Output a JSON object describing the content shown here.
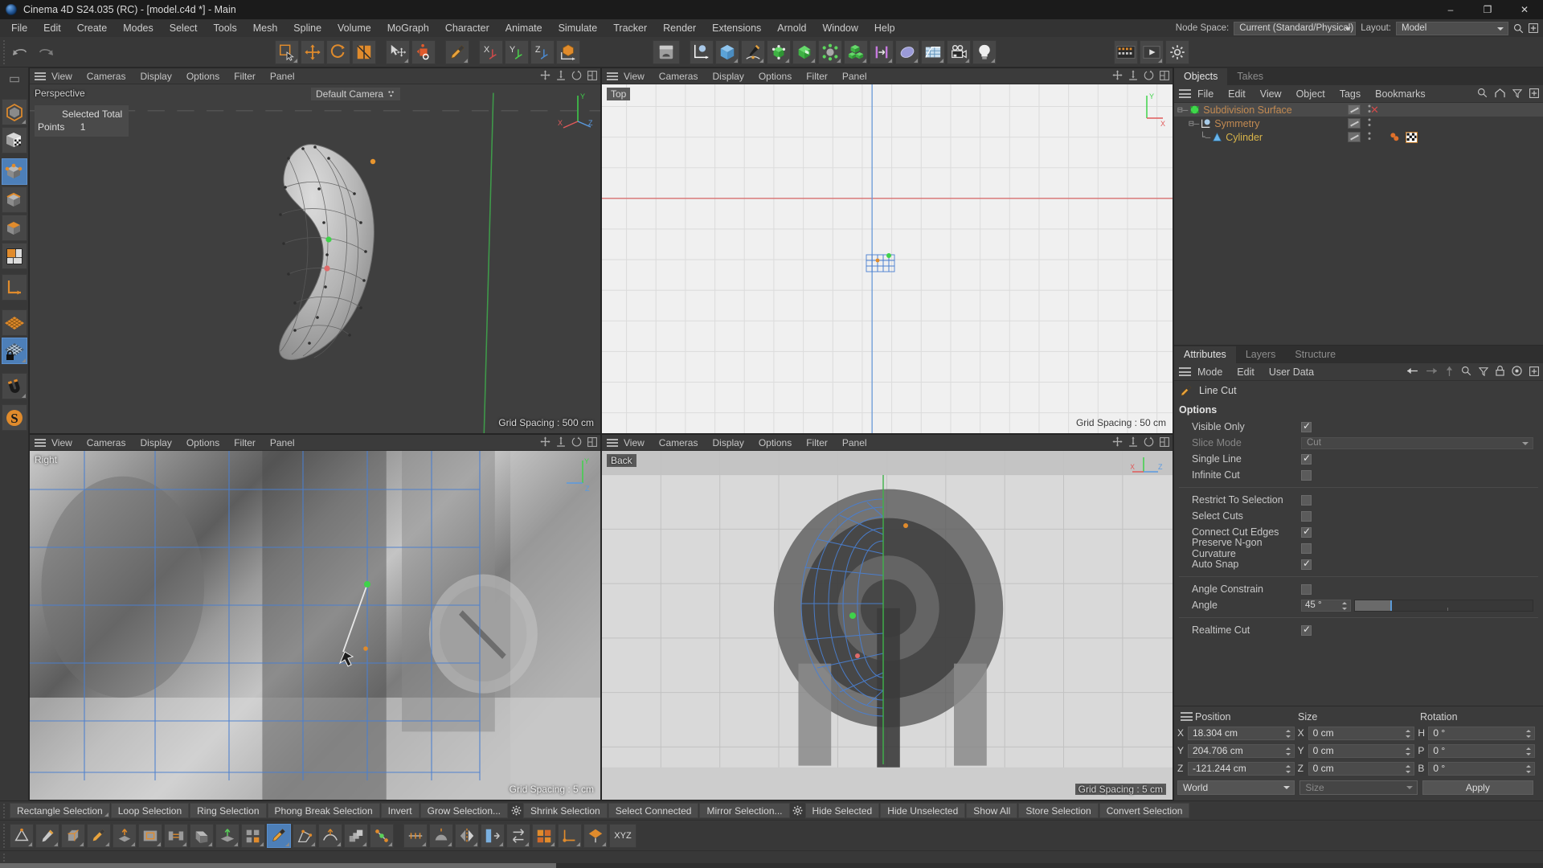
{
  "window": {
    "title": "Cinema 4D S24.035 (RC) - [model.c4d *] - Main",
    "minimize": "–",
    "maximize": "❐",
    "close": "✕"
  },
  "menubar": {
    "items": [
      "File",
      "Edit",
      "Create",
      "Modes",
      "Select",
      "Tools",
      "Mesh",
      "Spline",
      "Volume",
      "MoGraph",
      "Character",
      "Animate",
      "Simulate",
      "Tracker",
      "Render",
      "Extensions",
      "Arnold",
      "Window",
      "Help"
    ],
    "node_space_label": "Node Space:",
    "node_space_value": "Current (Standard/Physical)",
    "layout_label": "Layout:",
    "layout_value": "Model"
  },
  "toolbar": {
    "undo": "undo-icon",
    "redo": "redo-icon",
    "live_selection": "live-selection-icon",
    "move": "move-icon",
    "scale": "scale-icon",
    "rotate": "rotate-icon",
    "move_tool2": "move-axis-icon",
    "rotate_tool2": "rotate-world-icon",
    "knife": "knife-icon",
    "lock_x": "X",
    "lock_y": "Y",
    "lock_z": "Z",
    "world_object": "world-object-icon",
    "content_browser": "content-browser-icon",
    "null_object": "null-object-icon",
    "cube_primitive": "cube-primitive-icon",
    "pen_spline": "pen-spline-icon",
    "array_generator": "array-generator-icon",
    "subdivision_surface": "subdivision-surface-icon",
    "bend_deformer": "bend-deformer-icon",
    "cloner": "cloner-icon",
    "mograph_effector": "mograph-effector-icon",
    "field": "field-icon",
    "scene_nodes": "scene-nodes-icon",
    "camera": "camera-icon",
    "light": "light-icon",
    "render_view": "render-view-icon",
    "render_picture": "render-picture-icon",
    "render_settings": "render-settings-icon"
  },
  "leftbar": {
    "items": [
      {
        "name": "model-mode",
        "active": false
      },
      {
        "name": "texture-mode",
        "active": false
      },
      {
        "name": "points-mode",
        "active": true
      },
      {
        "name": "edges-mode",
        "active": false
      },
      {
        "name": "polygons-mode",
        "active": false
      },
      {
        "name": "uv-mode",
        "active": false
      },
      {
        "name": "axis-mode",
        "active": false
      },
      {
        "name": "workplane-mode",
        "active": false
      },
      {
        "name": "lock-workplane-mode",
        "active": true
      },
      {
        "name": "snap-mode",
        "active": false
      },
      {
        "name": "sculpt-mode",
        "active": false
      }
    ]
  },
  "viewport_menu": [
    "View",
    "Cameras",
    "Display",
    "Options",
    "Filter",
    "Panel"
  ],
  "viewports": [
    {
      "name": "perspective",
      "label": "Perspective",
      "camera": "Default Camera",
      "grid_spacing": "Grid Spacing : 500 cm",
      "grid_boxed": false,
      "selection_info": {
        "header": "Selected Total",
        "row_label": "Points",
        "row_value": "1"
      }
    },
    {
      "name": "top",
      "label": "Top",
      "grid_spacing": "Grid Spacing : 50 cm",
      "grid_boxed": false
    },
    {
      "name": "right",
      "label": "Right",
      "grid_spacing": "Grid Spacing : 5 cm",
      "grid_boxed": false
    },
    {
      "name": "back",
      "label": "Back",
      "grid_spacing": "Grid Spacing : 5 cm",
      "grid_boxed": true
    }
  ],
  "object_manager": {
    "tabs": [
      {
        "label": "Objects",
        "selected": true
      },
      {
        "label": "Takes",
        "selected": false
      }
    ],
    "menu": [
      "File",
      "Edit",
      "View",
      "Object",
      "Tags",
      "Bookmarks"
    ],
    "icons": [
      "search-icon",
      "home-icon",
      "filter-icon",
      "add-icon"
    ],
    "items": [
      {
        "name": "Subdivision Surface",
        "color": "#c28a52",
        "indent": 0,
        "selected": true,
        "icon": "subdivision-surface-icon",
        "has_x": true,
        "tags": []
      },
      {
        "name": "Symmetry",
        "color": "#c28a52",
        "indent": 1,
        "selected": false,
        "icon": "symmetry-icon",
        "has_x": false,
        "tags": []
      },
      {
        "name": "Cylinder",
        "color": "#d8b44a",
        "indent": 2,
        "selected": false,
        "icon": "cylinder-icon",
        "has_x": false,
        "tags": [
          "material-tag",
          "checker-tag"
        ]
      }
    ]
  },
  "attributes": {
    "tabs": [
      {
        "label": "Attributes",
        "selected": true
      },
      {
        "label": "Layers",
        "selected": false
      },
      {
        "label": "Structure",
        "selected": false
      }
    ],
    "menu": [
      "Mode",
      "Edit",
      "User Data"
    ],
    "icons": [
      "back-arrow-icon",
      "forward-arrow-icon",
      "up-arrow-icon",
      "search-icon",
      "filter-icon",
      "lock-icon",
      "target-icon",
      "add-icon"
    ],
    "tool_title": "Line Cut",
    "tool_icon": "knife-icon",
    "section_title": "Options",
    "rows": [
      {
        "label": "Visible Only",
        "type": "checkbox",
        "checked": true,
        "dim": false
      },
      {
        "label": "Slice Mode",
        "type": "dropdown",
        "value": "Cut",
        "dim": true
      },
      {
        "label": "Single Line",
        "type": "checkbox",
        "checked": true,
        "dim": false
      },
      {
        "label": "Infinite Cut",
        "type": "checkbox",
        "checked": false,
        "dim": false
      },
      {
        "label": "__sep__",
        "type": "separator"
      },
      {
        "label": "Restrict To Selection",
        "type": "checkbox",
        "checked": false,
        "dim": false
      },
      {
        "label": "Select Cuts",
        "type": "checkbox",
        "checked": false,
        "dim": false
      },
      {
        "label": "Connect Cut Edges",
        "type": "checkbox",
        "checked": true,
        "dim": false
      },
      {
        "label": "Preserve N-gon Curvature",
        "type": "checkbox",
        "checked": false,
        "dim": false
      },
      {
        "label": "Auto Snap",
        "type": "checkbox",
        "checked": true,
        "dim": false
      },
      {
        "label": "__sep__",
        "type": "separator"
      },
      {
        "label": "Angle Constrain",
        "type": "checkbox",
        "checked": false,
        "dim": false
      },
      {
        "label": "Angle",
        "type": "slider",
        "value": "45 °",
        "fill_percent": 20
      },
      {
        "label": "__sep__",
        "type": "separator"
      },
      {
        "label": "Realtime Cut",
        "type": "checkbox",
        "checked": true,
        "dim": false
      }
    ]
  },
  "coordinates": {
    "headers": [
      "Position",
      "Size",
      "Rotation"
    ],
    "position": [
      {
        "axis": "X",
        "value": "18.304 cm"
      },
      {
        "axis": "Y",
        "value": "204.706 cm"
      },
      {
        "axis": "Z",
        "value": "-121.244 cm"
      }
    ],
    "size": [
      {
        "axis": "X",
        "value": "0 cm"
      },
      {
        "axis": "Y",
        "value": "0 cm"
      },
      {
        "axis": "Z",
        "value": "0 cm"
      }
    ],
    "rotation": [
      {
        "axis": "H",
        "value": "0 °"
      },
      {
        "axis": "P",
        "value": "0 °"
      },
      {
        "axis": "B",
        "value": "0 °"
      }
    ],
    "coord_system": "World",
    "size_mode": "Size",
    "apply": "Apply"
  },
  "selection_toolbar": {
    "buttons": [
      {
        "label": "Rectangle Selection",
        "corner": true,
        "gear": false
      },
      {
        "label": "Loop Selection",
        "corner": false,
        "gear": false
      },
      {
        "label": "Ring Selection",
        "corner": false,
        "gear": false
      },
      {
        "label": "Phong Break Selection",
        "corner": false,
        "gear": false
      },
      {
        "label": "Invert",
        "corner": false,
        "gear": false
      },
      {
        "label": "Grow Selection...",
        "corner": false,
        "gear": true
      },
      {
        "label": "Shrink Selection",
        "corner": false,
        "gear": false
      },
      {
        "label": "Select Connected",
        "corner": false,
        "gear": false
      },
      {
        "label": "Mirror Selection...",
        "corner": false,
        "gear": true
      },
      {
        "label": "Hide Selected",
        "corner": false,
        "gear": false
      },
      {
        "label": "Hide Unselected",
        "corner": false,
        "gear": false
      },
      {
        "label": "Show All",
        "corner": false,
        "gear": false
      },
      {
        "label": "Store Selection",
        "corner": false,
        "gear": false
      },
      {
        "label": "Convert Selection",
        "corner": false,
        "gear": false
      }
    ]
  },
  "mesh_toolbar": {
    "items": [
      {
        "name": "close-polygon-hole-icon",
        "active": false
      },
      {
        "name": "brush-icon",
        "active": false
      },
      {
        "name": "bevel-icon",
        "active": false
      },
      {
        "name": "knife-line-cut-icon",
        "active": false
      },
      {
        "name": "extrude-icon",
        "active": false
      },
      {
        "name": "extrude-inner-icon",
        "active": false
      },
      {
        "name": "bridge-icon",
        "active": false
      },
      {
        "name": "solidify-icon",
        "active": false
      },
      {
        "name": "normal-move-icon",
        "active": false
      },
      {
        "name": "array-icon",
        "active": false
      },
      {
        "name": "line-cut-icon",
        "active": true
      },
      {
        "name": "polygon-pen-icon",
        "active": false
      },
      {
        "name": "smooth-shift-icon",
        "active": false
      },
      {
        "name": "matrix-extrude-icon",
        "active": false
      },
      {
        "name": "weld-icon",
        "active": false
      },
      {
        "name": "stitch-sew-icon",
        "active": false
      },
      {
        "name": "melt-icon",
        "active": false
      },
      {
        "name": "mirror-icon",
        "active": false
      },
      {
        "name": "align-normals-icon",
        "active": false
      },
      {
        "name": "reverse-normals-icon",
        "active": false
      },
      {
        "name": "set-point-value-icon",
        "active": false
      },
      {
        "name": "axis-center-icon",
        "active": false
      },
      {
        "name": "workplane-icon",
        "active": false
      }
    ],
    "xyz_label": "XYZ"
  }
}
